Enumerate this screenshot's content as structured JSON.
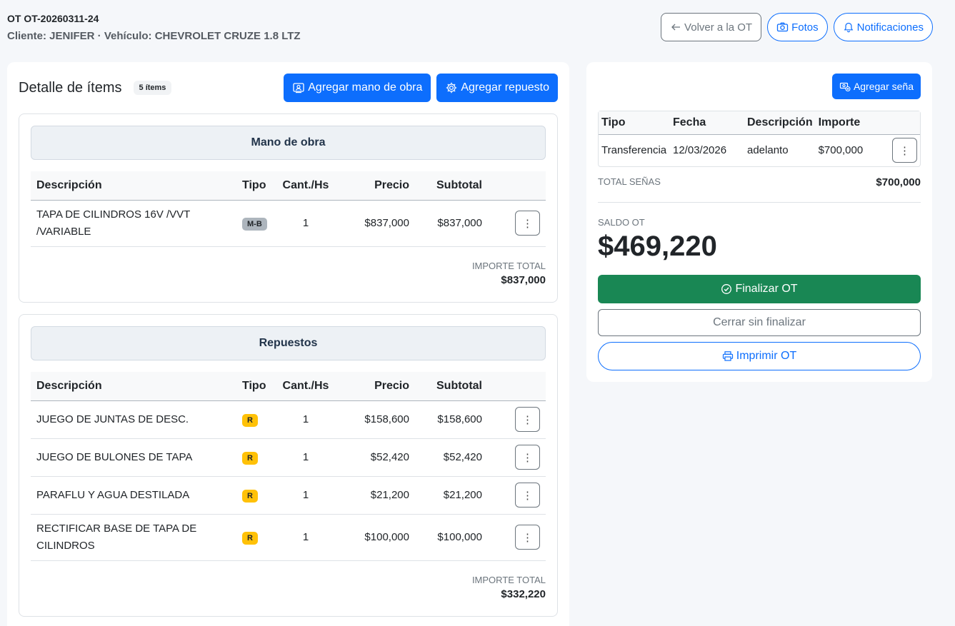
{
  "header": {
    "ot_title": "OT OT-20260311-24",
    "subtitle": "Cliente: JENIFER · Vehículo: CHEVROLET CRUZE 1.8 LTZ",
    "back_label": "Volver a la OT",
    "photos_label": "Fotos",
    "notifications_label": "Notificaciones"
  },
  "detail": {
    "title": "Detalle de ítems",
    "count": "5 ítems",
    "add_labor_label": "Agregar mano de obra",
    "add_part_label": "Agregar repuesto"
  },
  "columns": {
    "desc": "Descripción",
    "tipo": "Tipo",
    "cant": "Cant./Hs",
    "precio": "Precio",
    "subtotal": "Subtotal"
  },
  "labor": {
    "title": "Mano de obra",
    "rows": [
      {
        "desc": "TAPA DE CILINDROS 16V /VVT /VARIABLE",
        "tipo": "M-B",
        "cant": "1",
        "precio": "$837,000",
        "subtotal": "$837,000"
      }
    ],
    "total_label": "IMPORTE TOTAL",
    "total_value": "$837,000"
  },
  "parts": {
    "title": "Repuestos",
    "rows": [
      {
        "desc": "JUEGO DE JUNTAS DE DESC.",
        "tipo": "R",
        "cant": "1",
        "precio": "$158,600",
        "subtotal": "$158,600"
      },
      {
        "desc": "JUEGO DE BULONES DE TAPA",
        "tipo": "R",
        "cant": "1",
        "precio": "$52,420",
        "subtotal": "$52,420"
      },
      {
        "desc": "PARAFLU Y AGUA DESTILADA",
        "tipo": "R",
        "cant": "1",
        "precio": "$21,200",
        "subtotal": "$21,200"
      },
      {
        "desc": "RECTIFICAR BASE DE TAPA DE CILINDROS",
        "tipo": "R",
        "cant": "1",
        "precio": "$100,000",
        "subtotal": "$100,000"
      }
    ],
    "total_label": "IMPORTE TOTAL",
    "total_value": "$332,220"
  },
  "senas": {
    "add_label": "Agregar seña",
    "columns": {
      "tipo": "Tipo",
      "fecha": "Fecha",
      "desc": "Descripción",
      "importe": "Importe"
    },
    "rows": [
      {
        "tipo": "Transferencia",
        "fecha": "12/03/2026",
        "desc": "adelanto",
        "importe": "$700,000"
      }
    ],
    "total_label": "TOTAL SEÑAS",
    "total_value": "$700,000"
  },
  "saldo": {
    "label": "SALDO OT",
    "value": "$469,220"
  },
  "actions": {
    "finalizar": "Finalizar OT",
    "cerrar": "Cerrar sin finalizar",
    "imprimir": "Imprimir OT"
  },
  "colors": {
    "primary": "#0d6efd",
    "success": "#198754",
    "warning": "#ffc107",
    "secondary": "#6c757d"
  }
}
